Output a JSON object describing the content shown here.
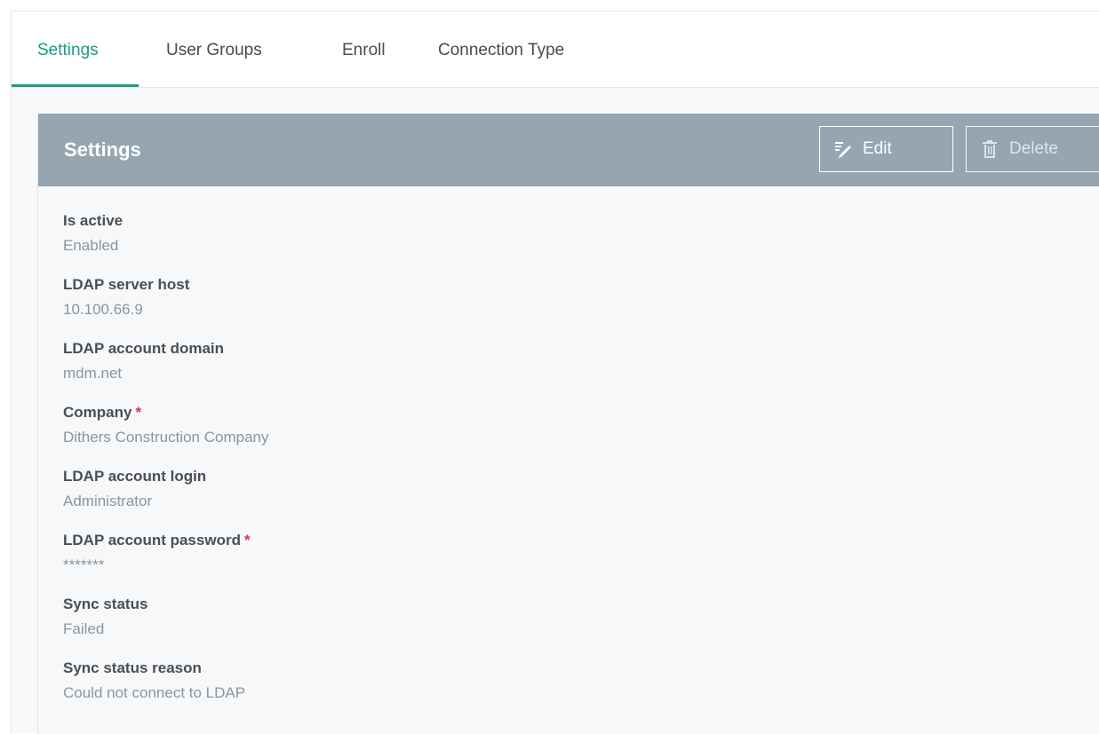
{
  "tabs": [
    {
      "label": "Settings",
      "active": true
    },
    {
      "label": "User Groups",
      "active": false
    },
    {
      "label": "Enroll",
      "active": false
    },
    {
      "label": "Connection Type",
      "active": false
    }
  ],
  "panel": {
    "title": "Settings",
    "edit_label": "Edit",
    "delete_label": "Delete"
  },
  "fields": [
    {
      "label": "Is active",
      "value": "Enabled",
      "required": false
    },
    {
      "label": "LDAP server host",
      "value": "10.100.66.9",
      "required": false
    },
    {
      "label": "LDAP account domain",
      "value": "mdm.net",
      "required": false
    },
    {
      "label": "Company",
      "value": "Dithers Construction Company",
      "required": true
    },
    {
      "label": "LDAP account login",
      "value": "Administrator",
      "required": false
    },
    {
      "label": "LDAP account password",
      "value": "*******",
      "required": true
    },
    {
      "label": "Sync status",
      "value": "Failed",
      "required": false
    },
    {
      "label": "Sync status reason",
      "value": "Could not connect to LDAP",
      "required": false
    }
  ],
  "required_mark": "*",
  "colors": {
    "accent": "#1a9c83",
    "header": "#95a6b2",
    "required": "#d9373f"
  }
}
